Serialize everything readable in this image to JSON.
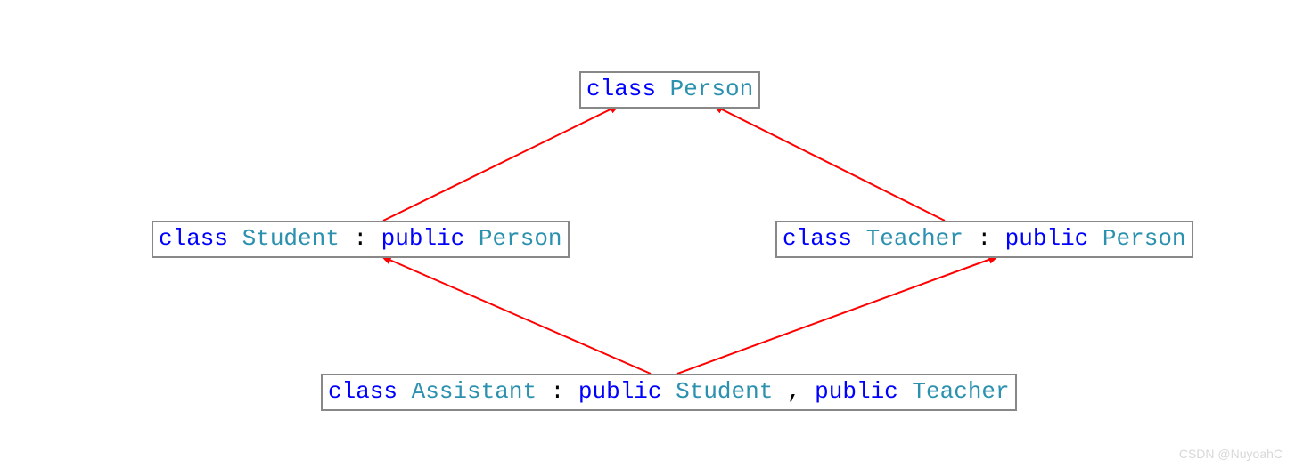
{
  "boxes": {
    "person": {
      "keyword": "class",
      "name": "Person"
    },
    "student": {
      "keyword": "class",
      "name": "Student",
      "colon": ":",
      "access1": "public",
      "base1": "Person"
    },
    "teacher": {
      "keyword": "class",
      "name": "Teacher",
      "colon": ":",
      "access1": "public",
      "base1": "Person"
    },
    "assistant": {
      "keyword": "class",
      "name": "Assistant",
      "colon": ":",
      "access1": "public",
      "base1": "Student",
      "comma": ",",
      "access2": "public",
      "base2": "Teacher"
    }
  },
  "arrows": {
    "color": "#ff0000"
  },
  "watermark": "CSDN @NuyoahC"
}
